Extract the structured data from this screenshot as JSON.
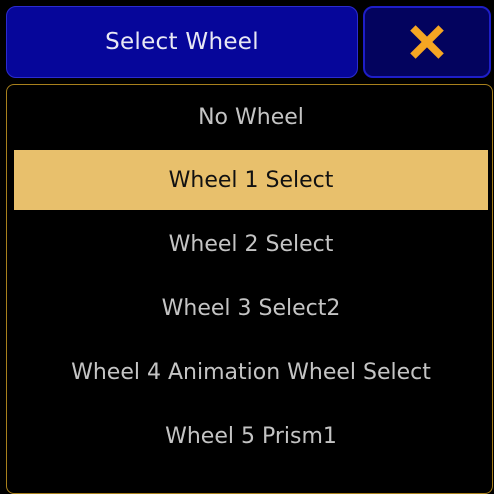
{
  "dialog": {
    "title": "Select Wheel",
    "close_icon": "close-x-icon"
  },
  "colors": {
    "title_bg": "#06069a",
    "close_bg": "#03035e",
    "close_icon": "#f5a623",
    "selected_bg": "#e8c06c",
    "panel_border": "#a8801c",
    "item_text": "#c4c4c4"
  },
  "wheels": {
    "selected_index": 1,
    "items": [
      {
        "label": "No Wheel"
      },
      {
        "label": "Wheel 1 Select"
      },
      {
        "label": "Wheel 2 Select"
      },
      {
        "label": "Wheel 3 Select2"
      },
      {
        "label": "Wheel 4 Animation Wheel Select"
      },
      {
        "label": "Wheel 5 Prism1"
      }
    ]
  }
}
